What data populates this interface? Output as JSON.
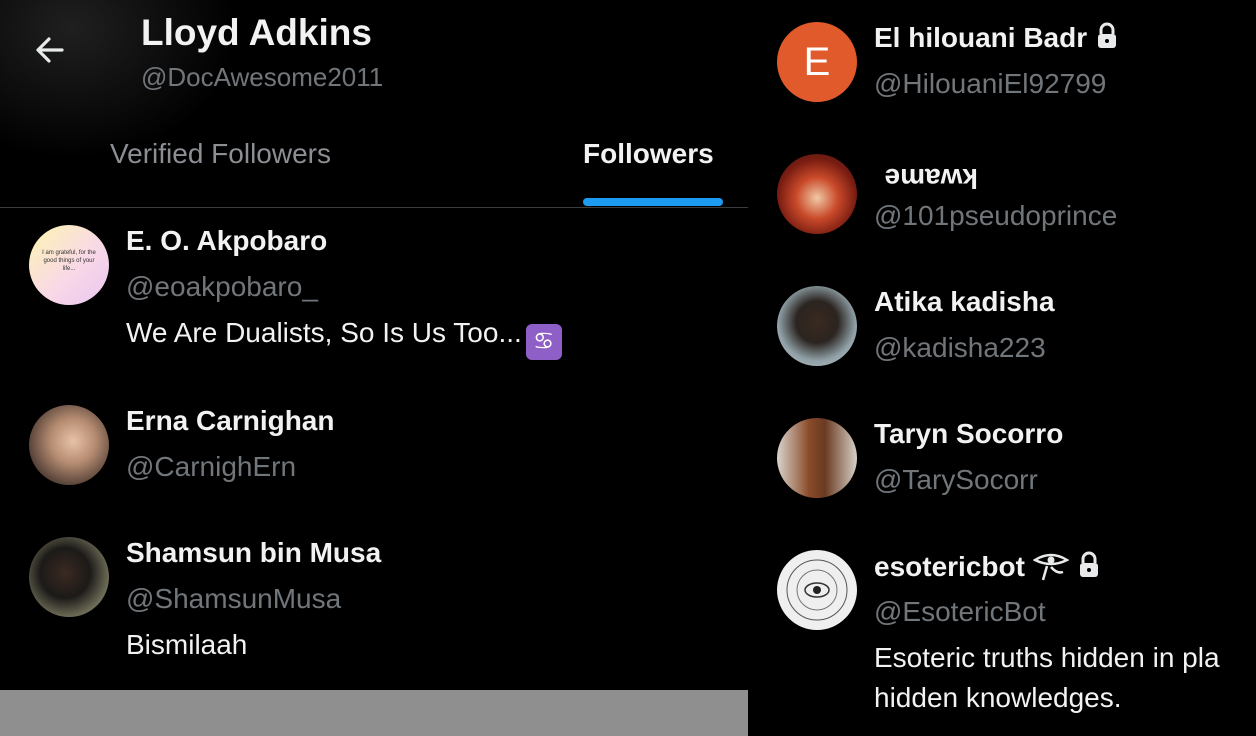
{
  "header": {
    "name": "Lloyd Adkins",
    "handle": "@DocAwesome2011"
  },
  "tabs": [
    {
      "label": "Verified Followers",
      "active": false
    },
    {
      "label": "Followers",
      "active": true
    }
  ],
  "accent_color": "#1d9bf0",
  "left_list": [
    {
      "name": "E. O. Akpobaro",
      "handle": "@eoakpobaro_",
      "bio": "We Are Dualists, So Is Us Too...",
      "bio_emoji": "cancer-zodiac-icon",
      "avatar_text": "I am grateful, for the good things of your life..."
    },
    {
      "name": "Erna Carnighan",
      "handle": "@CarnighErn"
    },
    {
      "name": "Shamsun bin Musa",
      "handle": "@ShamsunMusa",
      "bio": "Bismilaah"
    }
  ],
  "right_list": [
    {
      "name": "El hilouani Badr",
      "handle": "@HilouaniEl92799",
      "locked": true,
      "avatar_letter": "E",
      "avatar_color": "#e05a2b"
    },
    {
      "name": "kwame",
      "handle": "@101pseudoprince",
      "name_upside_down": true
    },
    {
      "name": "Atika kadisha",
      "handle": "@kadisha223"
    },
    {
      "name": "Taryn Socorro",
      "handle": "@TarySocorr"
    },
    {
      "name": "esotericbot",
      "handle": "@EsotericBot",
      "locked": true,
      "name_icon": "eye-of-horus-icon",
      "bio_line1": "Esoteric truths hidden in pla",
      "bio_line2": "hidden knowledges."
    }
  ]
}
